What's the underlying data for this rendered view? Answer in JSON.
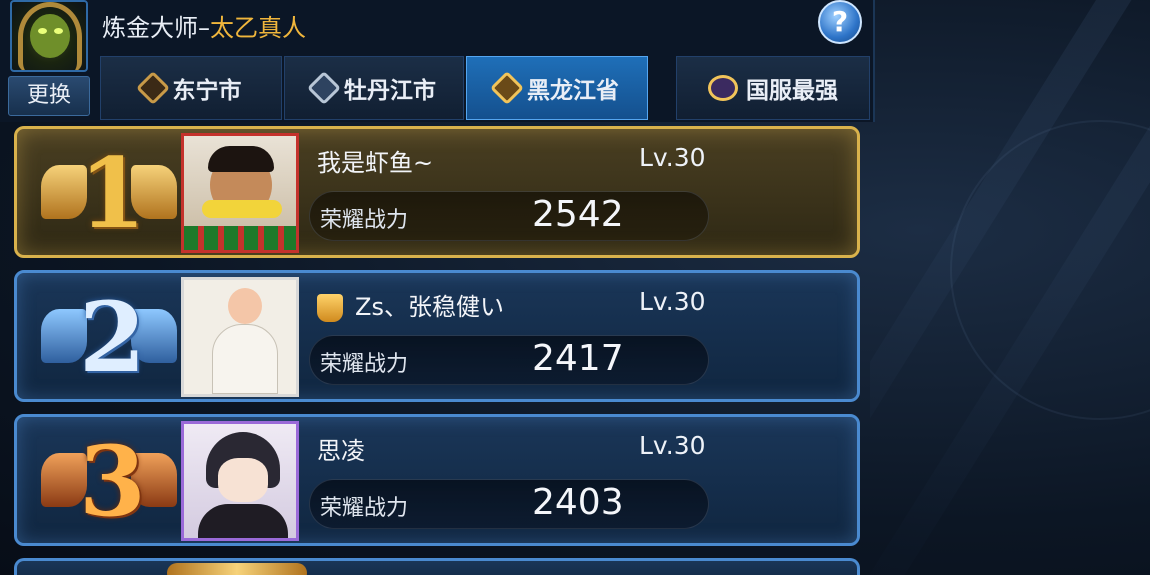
{
  "header": {
    "title_prefix": "炼金大师–",
    "title_name": "太乙真人",
    "change_label": "更换",
    "help_label": "?"
  },
  "tabs": [
    {
      "label": "东宁市",
      "icon": "bronze-diamond-icon",
      "active": false
    },
    {
      "label": "牡丹江市",
      "icon": "silver-diamond-icon",
      "active": false
    },
    {
      "label": "黑龙江省",
      "icon": "gold-diamond-icon",
      "active": true
    },
    {
      "label": "国服最强",
      "icon": "crown-emblem-icon",
      "active": false
    }
  ],
  "rankings": [
    {
      "rank": "1",
      "name": "我是虾鱼~",
      "level": "Lv.30",
      "power_label": "荣耀战力",
      "power": "2542"
    },
    {
      "rank": "2",
      "name": "Zs、张稳健い",
      "level": "Lv.30",
      "power_label": "荣耀战力",
      "power": "2417"
    },
    {
      "rank": "3",
      "name": "思凌",
      "level": "Lv.30",
      "power_label": "荣耀战力",
      "power": "2403"
    }
  ],
  "colors": {
    "accent_blue": "#1f6fb8",
    "gold": "#f0b63c",
    "card_gold_border": "#d9b24c",
    "card_blue_border": "#4a8ad0"
  }
}
